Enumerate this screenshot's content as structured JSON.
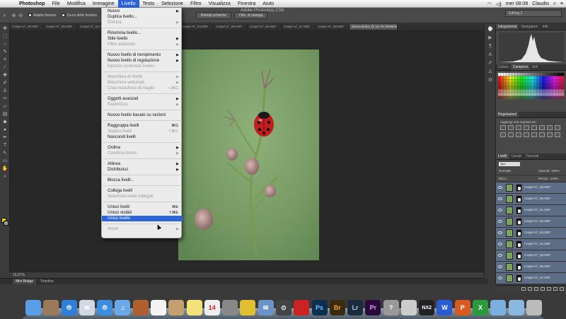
{
  "menubar": {
    "app": "Photoshop",
    "items": [
      "File",
      "Modifica",
      "Immagine",
      "Livello",
      "Testo",
      "Selezione",
      "Filtro",
      "Visualizza",
      "Finestra",
      "Aiuto"
    ],
    "active": "Livello",
    "clock": "mer 08:08",
    "user": "Claudio"
  },
  "optionsbar": {
    "checkbox1": "Adatta finestre",
    "checkbox2": "Zoom delle finestre",
    "btn1": "Riempi schermo",
    "btn2": "Dim. di stampa"
  },
  "window_title": "Adobe Photoshop CS6",
  "workspace": "Editing 2",
  "doc_tabs": [
    "Caspri-N°_59.NEF",
    "Caspri-N°_60.NEF",
    "Caspri-N°_61.NEF",
    "Caspri-N°_62.NEF",
    "Caspri-N°_63.NEF",
    "Caspri-N°_64.NEF",
    "Caspri-N°_65.NEF",
    "Caspri-N°_66.NEF",
    "Caspri-N°_67.NEF",
    "Caspri-N°_68.NEF",
    "Senza titolo1 @ 16,7% (RGB/16) *"
  ],
  "statusbar": {
    "zoom": "16,67%"
  },
  "bottom_tabs": [
    "Mini Bridge",
    "Timeline"
  ],
  "menu": {
    "groups": [
      [
        {
          "label": "Nuovo",
          "arrow": true
        },
        {
          "label": "Duplica livello..."
        },
        {
          "label": "Elimina",
          "disabled": true,
          "arrow": true
        }
      ],
      [
        {
          "label": "Rinomina livello..."
        },
        {
          "label": "Stile livello",
          "arrow": true
        },
        {
          "label": "Filtro avanzato",
          "disabled": true,
          "arrow": true
        }
      ],
      [
        {
          "label": "Nuovo livello di riempimento",
          "arrow": true
        },
        {
          "label": "Nuovo livello di regolazione",
          "arrow": true
        },
        {
          "label": "Opzioni contenuto livello...",
          "disabled": true
        }
      ],
      [
        {
          "label": "Maschera di livello",
          "disabled": true,
          "arrow": true
        },
        {
          "label": "Maschera vettoriale",
          "disabled": true,
          "arrow": true
        },
        {
          "label": "Crea maschera di ritaglio",
          "disabled": true,
          "shortcut": "⌥⌘G"
        }
      ],
      [
        {
          "label": "Oggetti avanzati",
          "arrow": true
        },
        {
          "label": "Rasterizza",
          "disabled": true,
          "arrow": true
        }
      ],
      [
        {
          "label": "Nuovo livello basato su sezioni"
        }
      ],
      [
        {
          "label": "Raggruppa livelli",
          "shortcut": "⌘G"
        },
        {
          "label": "Separa livelli",
          "disabled": true,
          "shortcut": "⇧⌘G"
        },
        {
          "label": "Nascondi livelli"
        }
      ],
      [
        {
          "label": "Ordina",
          "arrow": true
        },
        {
          "label": "Combina forme",
          "disabled": true,
          "arrow": true
        }
      ],
      [
        {
          "label": "Allinea",
          "arrow": true
        },
        {
          "label": "Distribuisci",
          "arrow": true
        }
      ],
      [
        {
          "label": "Blocca livelli..."
        }
      ],
      [
        {
          "label": "Collega livelli"
        },
        {
          "label": "Seleziona livelli collegati",
          "disabled": true
        }
      ],
      [
        {
          "label": "Unisci livelli",
          "shortcut": "⌘E"
        },
        {
          "label": "Unisci visibili",
          "shortcut": "⇧⌘E"
        },
        {
          "label": "Unico livello",
          "selected": true
        }
      ],
      [
        {
          "label": "Alone",
          "disabled": true,
          "arrow": true
        }
      ]
    ]
  },
  "panels": {
    "top_tabs": [
      "Istogramma",
      "Navigatore",
      "Info"
    ],
    "color_tabs": [
      "Colore",
      "Campioni",
      "Stili"
    ],
    "adjust_tab": "Regolazioni",
    "adjust_label": "Aggiungi una regolazione",
    "layer_tabs": [
      "Livelli",
      "Canali",
      "Tracciati"
    ],
    "kind": "Tipo",
    "blend": "Normale",
    "opacity_label": "Opacità:",
    "opacity": "100%",
    "lock_label": "Blocc.:",
    "fill_label": "Riemp.:",
    "fill": "100%",
    "layers": [
      "Caspri-N°_59.NEF",
      "Caspri-N°_60.NEF",
      "Caspri-N°_61.NEF",
      "Caspri-N°_62.NEF",
      "Caspri-N°_63.NEF",
      "Caspri-N°_64.NEF",
      "Caspri-N°_65.NEF",
      "Caspri-N°_66.NEF",
      "Caspri-N°_67.NEF"
    ]
  },
  "dock": {
    "apps": [
      "Finder",
      "Photos",
      "Safari",
      "Mail",
      "Safari-2",
      "iTunes",
      "Book",
      "Calendar",
      "Contacts",
      "Notes",
      "Calendar-14",
      "Grab",
      "Stickies",
      "Mail-2",
      "Screen",
      "Photo Booth",
      "Ps",
      "Br",
      "Lr",
      "Pr",
      "Help",
      "Preview",
      "NX2",
      "Word",
      "PowerPoint",
      "Excel",
      "Downloads",
      "Documents",
      "Trash"
    ],
    "cal_day": "14"
  }
}
